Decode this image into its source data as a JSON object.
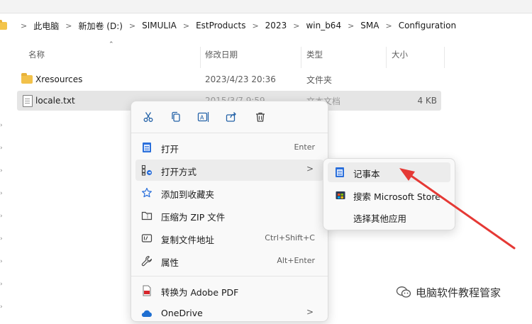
{
  "address": {
    "crumbs": [
      "此电脑",
      "新加卷 (D:)",
      "SIMULIA",
      "EstProducts",
      "2023",
      "win_b64",
      "SMA",
      "Configuration"
    ],
    "sep": ">"
  },
  "columns": {
    "name": "名称",
    "date": "修改日期",
    "type": "类型",
    "size": "大小"
  },
  "files": [
    {
      "name": "Xresources",
      "date": "2023/4/23 20:36",
      "type": "文件夹",
      "size": ""
    },
    {
      "name": "locale.txt",
      "date": "2015/3/7 9:59",
      "type": "文本文档",
      "size": "4 KB"
    }
  ],
  "context_menu": {
    "items": [
      {
        "label": "打开",
        "shortcut": "Enter",
        "icon": "notepad-icon"
      },
      {
        "label": "打开方式",
        "shortcut": "",
        "icon": "open-with-icon",
        "chevron": ">"
      },
      {
        "label": "添加到收藏夹",
        "shortcut": "",
        "icon": "star-icon"
      },
      {
        "label": "压缩为 ZIP 文件",
        "shortcut": "",
        "icon": "zip-icon"
      },
      {
        "label": "复制文件地址",
        "shortcut": "Ctrl+Shift+C",
        "icon": "copy-path-icon"
      },
      {
        "label": "属性",
        "shortcut": "Alt+Enter",
        "icon": "wrench-icon"
      },
      {
        "label": "转换为 Adobe PDF",
        "shortcut": "",
        "icon": "pdf-icon"
      },
      {
        "label": "OneDrive",
        "shortcut": "",
        "icon": "cloud-icon",
        "chevron": ">"
      }
    ]
  },
  "submenu": {
    "items": [
      {
        "label": "记事本",
        "icon": "notepad-icon"
      },
      {
        "label": "搜索 Microsoft Store",
        "icon": "store-icon"
      },
      {
        "label": "选择其他应用",
        "icon": ""
      }
    ]
  },
  "watermark": {
    "text": "电脑软件教程管家"
  },
  "colors": {
    "accent": "#0067c0",
    "arrow": "#e53935",
    "folder": "#f2c14a"
  }
}
